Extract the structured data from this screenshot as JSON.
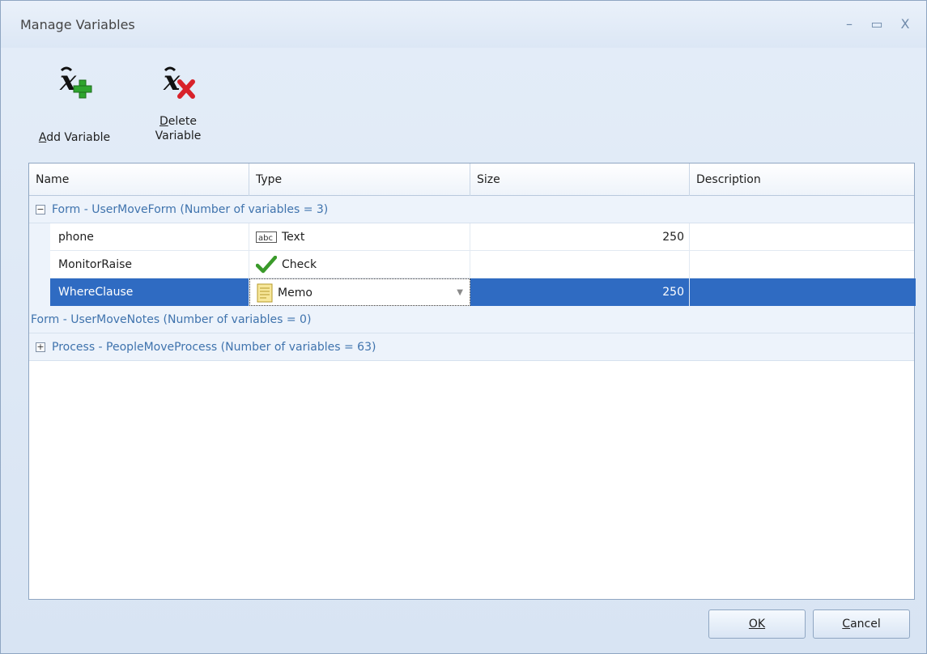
{
  "window": {
    "title": "Manage Variables",
    "minimize_glyph": "–",
    "maximize_glyph": "▭",
    "close_glyph": "X"
  },
  "toolbar": {
    "add": {
      "label": "Add Variable",
      "icon": "add-variable-icon"
    },
    "delete": {
      "label_line1": "Delete",
      "label_line2": "Variable",
      "icon": "delete-variable-icon"
    }
  },
  "grid": {
    "columns": [
      "Name",
      "Type",
      "Size",
      "Description"
    ],
    "groups": [
      {
        "label": "Form - UserMoveForm (Number of variables = 3)",
        "expanded": true,
        "expander_glyph": "−",
        "rows": [
          {
            "name": "phone",
            "type": "Text",
            "type_icon": "text-type-icon",
            "size": "250",
            "description": ""
          },
          {
            "name": "MonitorRaise",
            "type": "Check",
            "type_icon": "check-type-icon",
            "size": "",
            "description": ""
          },
          {
            "name": "WhereClause",
            "type": "Memo",
            "type_icon": "memo-type-icon",
            "size": "250",
            "description": "",
            "selected": true
          }
        ]
      },
      {
        "label": "Form - UserMoveNotes (Number of variables = 0)",
        "expanded": false
      },
      {
        "label": "Process - PeopleMoveProcess (Number of variables = 63)",
        "expanded": false,
        "expander_glyph": "+"
      }
    ]
  },
  "buttons": {
    "ok": "OK",
    "cancel": "Cancel"
  },
  "colors": {
    "selection": "#2f6bc2",
    "group_text": "#3f73ad"
  }
}
